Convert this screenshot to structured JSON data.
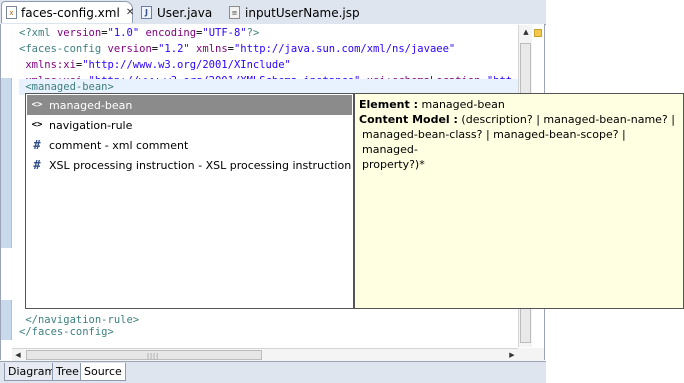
{
  "tabs": [
    {
      "label": "faces-config.xml",
      "icon": "xml-file-icon",
      "active": true,
      "closable": true
    },
    {
      "label": "User.java",
      "icon": "java-file-icon",
      "active": false
    },
    {
      "label": "inputUserName.jsp",
      "icon": "jsp-file-icon",
      "active": false
    }
  ],
  "code": {
    "line1": {
      "a": "<?xml ",
      "b": "version",
      "c": "=",
      "d": "\"1.0\"",
      "e": " ",
      "f": "encoding",
      "g": "=",
      "h": "\"UTF-8\"",
      "i": "?>"
    },
    "line2": {
      "a": "<faces-config ",
      "b": "version",
      "c": "=",
      "d": "\"1.2\"",
      "e": " ",
      "f": "xmlns",
      "g": "=",
      "h": "\"http://java.sun.com/xml/ns/javaee\""
    },
    "line3": {
      "a": " xmlns:xi",
      "b": "=",
      "c": "\"http://www.w3.org/2001/XInclude\""
    },
    "line4": {
      "a": " xmlns:xsi",
      "b": "=",
      "c": "\"http://www.w3.org/2001/XMLSchema-instance\"",
      "d": " ",
      "e": "xsi:schemaLocation",
      "f": "=",
      "g": "\"htt"
    },
    "line5": " <managed-bean>",
    "line_nav_end": " </navigation-rule>",
    "line_fc_end": "</faces-config>"
  },
  "assist": {
    "items": [
      {
        "icon": "element-icon",
        "glyph": "<>",
        "label": "managed-bean",
        "selected": true
      },
      {
        "icon": "element-icon",
        "glyph": "<>",
        "label": "navigation-rule"
      },
      {
        "icon": "hash-icon",
        "glyph": "#",
        "label": "comment - xml comment"
      },
      {
        "icon": "hash-icon",
        "glyph": "#",
        "label": "XSL processing instruction - XSL processing instruction"
      }
    ]
  },
  "info": {
    "element_label": "Element :",
    "element_value": " managed-bean",
    "content_label": "Content Model :",
    "content_value_1": " (description? | managed-bean-name? |",
    "content_value_2": "managed-bean-class? | managed-bean-scope? | managed-",
    "content_value_3": "property?)*"
  },
  "bottom_tabs": [
    "Diagram",
    "Tree",
    "Source"
  ],
  "colors": {
    "tag": "#3f7f7f",
    "attr": "#7f007f",
    "value": "#2a00ff",
    "tooltip_bg": "#ffffe1",
    "selection": "#8b8b8b"
  }
}
